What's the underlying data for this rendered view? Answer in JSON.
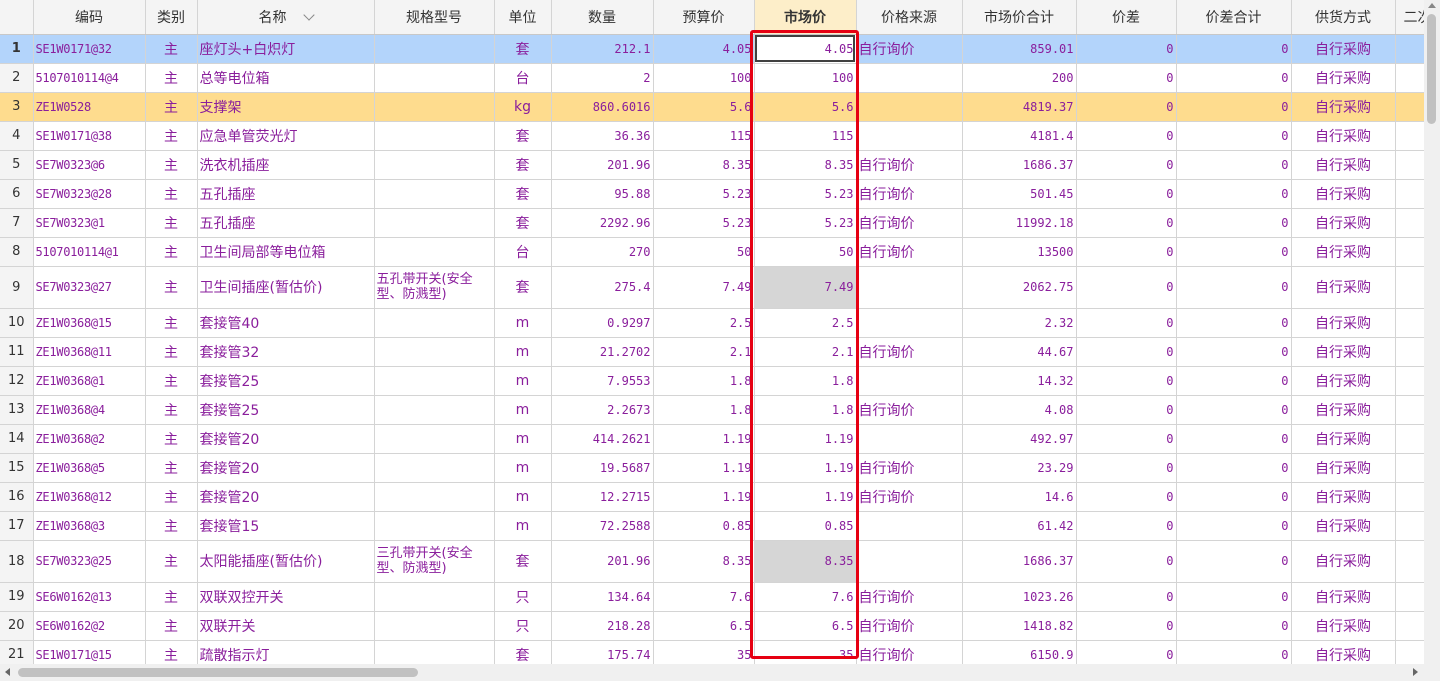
{
  "columns": [
    "编码",
    "类别",
    "名称",
    "规格型号",
    "单位",
    "数量",
    "预算价",
    "市场价",
    "价格来源",
    "市场价合计",
    "价差",
    "价差合计",
    "供货方式",
    "二次"
  ],
  "rows": [
    {
      "n": "1",
      "code": "SE1W0171@32",
      "type": "主",
      "name": "座灯头+白炽灯",
      "spec": "",
      "unit": "套",
      "qty": "212.1",
      "budget": "4.05",
      "market": "4.05",
      "source": "自行询价",
      "total": "859.01",
      "diff": "0",
      "diff_total": "0",
      "supply": "自行采购"
    },
    {
      "n": "2",
      "code": "5107010114@4",
      "type": "主",
      "name": "总等电位箱",
      "spec": "",
      "unit": "台",
      "qty": "2",
      "budget": "100",
      "market": "100",
      "source": "",
      "total": "200",
      "diff": "0",
      "diff_total": "0",
      "supply": "自行采购"
    },
    {
      "n": "3",
      "code": "ZE1W0528",
      "type": "主",
      "name": "支撑架",
      "spec": "",
      "unit": "kg",
      "qty": "860.6016",
      "budget": "5.6",
      "market": "5.6",
      "source": "",
      "total": "4819.37",
      "diff": "0",
      "diff_total": "0",
      "supply": "自行采购"
    },
    {
      "n": "4",
      "code": "SE1W0171@38",
      "type": "主",
      "name": "应急单管荧光灯",
      "spec": "",
      "unit": "套",
      "qty": "36.36",
      "budget": "115",
      "market": "115",
      "source": "",
      "total": "4181.4",
      "diff": "0",
      "diff_total": "0",
      "supply": "自行采购"
    },
    {
      "n": "5",
      "code": "SE7W0323@6",
      "type": "主",
      "name": "洗衣机插座",
      "spec": "",
      "unit": "套",
      "qty": "201.96",
      "budget": "8.35",
      "market": "8.35",
      "source": "自行询价",
      "total": "1686.37",
      "diff": "0",
      "diff_total": "0",
      "supply": "自行采购"
    },
    {
      "n": "6",
      "code": "SE7W0323@28",
      "type": "主",
      "name": "五孔插座",
      "spec": "",
      "unit": "套",
      "qty": "95.88",
      "budget": "5.23",
      "market": "5.23",
      "source": "自行询价",
      "total": "501.45",
      "diff": "0",
      "diff_total": "0",
      "supply": "自行采购"
    },
    {
      "n": "7",
      "code": "SE7W0323@1",
      "type": "主",
      "name": "五孔插座",
      "spec": "",
      "unit": "套",
      "qty": "2292.96",
      "budget": "5.23",
      "market": "5.23",
      "source": "自行询价",
      "total": "11992.18",
      "diff": "0",
      "diff_total": "0",
      "supply": "自行采购"
    },
    {
      "n": "8",
      "code": "5107010114@1",
      "type": "主",
      "name": "卫生间局部等电位箱",
      "spec": "",
      "unit": "台",
      "qty": "270",
      "budget": "50",
      "market": "50",
      "source": "自行询价",
      "total": "13500",
      "diff": "0",
      "diff_total": "0",
      "supply": "自行采购"
    },
    {
      "n": "9",
      "code": "SE7W0323@27",
      "type": "主",
      "name": "卫生间插座(暂估价)",
      "spec": "五孔带开关(安全型、防溅型)",
      "unit": "套",
      "qty": "275.4",
      "budget": "7.49",
      "market": "7.49",
      "source": "",
      "total": "2062.75",
      "diff": "0",
      "diff_total": "0",
      "supply": "自行采购"
    },
    {
      "n": "10",
      "code": "ZE1W0368@15",
      "type": "主",
      "name": "套接管40",
      "spec": "",
      "unit": "m",
      "qty": "0.9297",
      "budget": "2.5",
      "market": "2.5",
      "source": "",
      "total": "2.32",
      "diff": "0",
      "diff_total": "0",
      "supply": "自行采购"
    },
    {
      "n": "11",
      "code": "ZE1W0368@11",
      "type": "主",
      "name": "套接管32",
      "spec": "",
      "unit": "m",
      "qty": "21.2702",
      "budget": "2.1",
      "market": "2.1",
      "source": "自行询价",
      "total": "44.67",
      "diff": "0",
      "diff_total": "0",
      "supply": "自行采购"
    },
    {
      "n": "12",
      "code": "ZE1W0368@1",
      "type": "主",
      "name": "套接管25",
      "spec": "",
      "unit": "m",
      "qty": "7.9553",
      "budget": "1.8",
      "market": "1.8",
      "source": "",
      "total": "14.32",
      "diff": "0",
      "diff_total": "0",
      "supply": "自行采购"
    },
    {
      "n": "13",
      "code": "ZE1W0368@4",
      "type": "主",
      "name": "套接管25",
      "spec": "",
      "unit": "m",
      "qty": "2.2673",
      "budget": "1.8",
      "market": "1.8",
      "source": "自行询价",
      "total": "4.08",
      "diff": "0",
      "diff_total": "0",
      "supply": "自行采购"
    },
    {
      "n": "14",
      "code": "ZE1W0368@2",
      "type": "主",
      "name": "套接管20",
      "spec": "",
      "unit": "m",
      "qty": "414.2621",
      "budget": "1.19",
      "market": "1.19",
      "source": "",
      "total": "492.97",
      "diff": "0",
      "diff_total": "0",
      "supply": "自行采购"
    },
    {
      "n": "15",
      "code": "ZE1W0368@5",
      "type": "主",
      "name": "套接管20",
      "spec": "",
      "unit": "m",
      "qty": "19.5687",
      "budget": "1.19",
      "market": "1.19",
      "source": "自行询价",
      "total": "23.29",
      "diff": "0",
      "diff_total": "0",
      "supply": "自行采购"
    },
    {
      "n": "16",
      "code": "ZE1W0368@12",
      "type": "主",
      "name": "套接管20",
      "spec": "",
      "unit": "m",
      "qty": "12.2715",
      "budget": "1.19",
      "market": "1.19",
      "source": "自行询价",
      "total": "14.6",
      "diff": "0",
      "diff_total": "0",
      "supply": "自行采购"
    },
    {
      "n": "17",
      "code": "ZE1W0368@3",
      "type": "主",
      "name": "套接管15",
      "spec": "",
      "unit": "m",
      "qty": "72.2588",
      "budget": "0.85",
      "market": "0.85",
      "source": "",
      "total": "61.42",
      "diff": "0",
      "diff_total": "0",
      "supply": "自行采购"
    },
    {
      "n": "18",
      "code": "SE7W0323@25",
      "type": "主",
      "name": "太阳能插座(暂估价)",
      "spec": "三孔带开关(安全型、防溅型)",
      "unit": "套",
      "qty": "201.96",
      "budget": "8.35",
      "market": "8.35",
      "source": "",
      "total": "1686.37",
      "diff": "0",
      "diff_total": "0",
      "supply": "自行采购"
    },
    {
      "n": "19",
      "code": "SE6W0162@13",
      "type": "主",
      "name": "双联双控开关",
      "spec": "",
      "unit": "只",
      "qty": "134.64",
      "budget": "7.6",
      "market": "7.6",
      "source": "自行询价",
      "total": "1023.26",
      "diff": "0",
      "diff_total": "0",
      "supply": "自行采购"
    },
    {
      "n": "20",
      "code": "SE6W0162@2",
      "type": "主",
      "name": "双联开关",
      "spec": "",
      "unit": "只",
      "qty": "218.28",
      "budget": "6.5",
      "market": "6.5",
      "source": "自行询价",
      "total": "1418.82",
      "diff": "0",
      "diff_total": "0",
      "supply": "自行采购"
    },
    {
      "n": "21",
      "code": "SE1W0171@15",
      "type": "主",
      "name": "疏散指示灯",
      "spec": "",
      "unit": "套",
      "qty": "175.74",
      "budget": "35",
      "market": "35",
      "source": "自行询价",
      "total": "6150.9",
      "diff": "0",
      "diff_total": "0",
      "supply": "自行采购"
    }
  ],
  "colors": {
    "selected_row": "#b3d4fb",
    "band_row": "#fedc8e",
    "highlight_box": "#e60012",
    "text": "#8a1e9c"
  }
}
